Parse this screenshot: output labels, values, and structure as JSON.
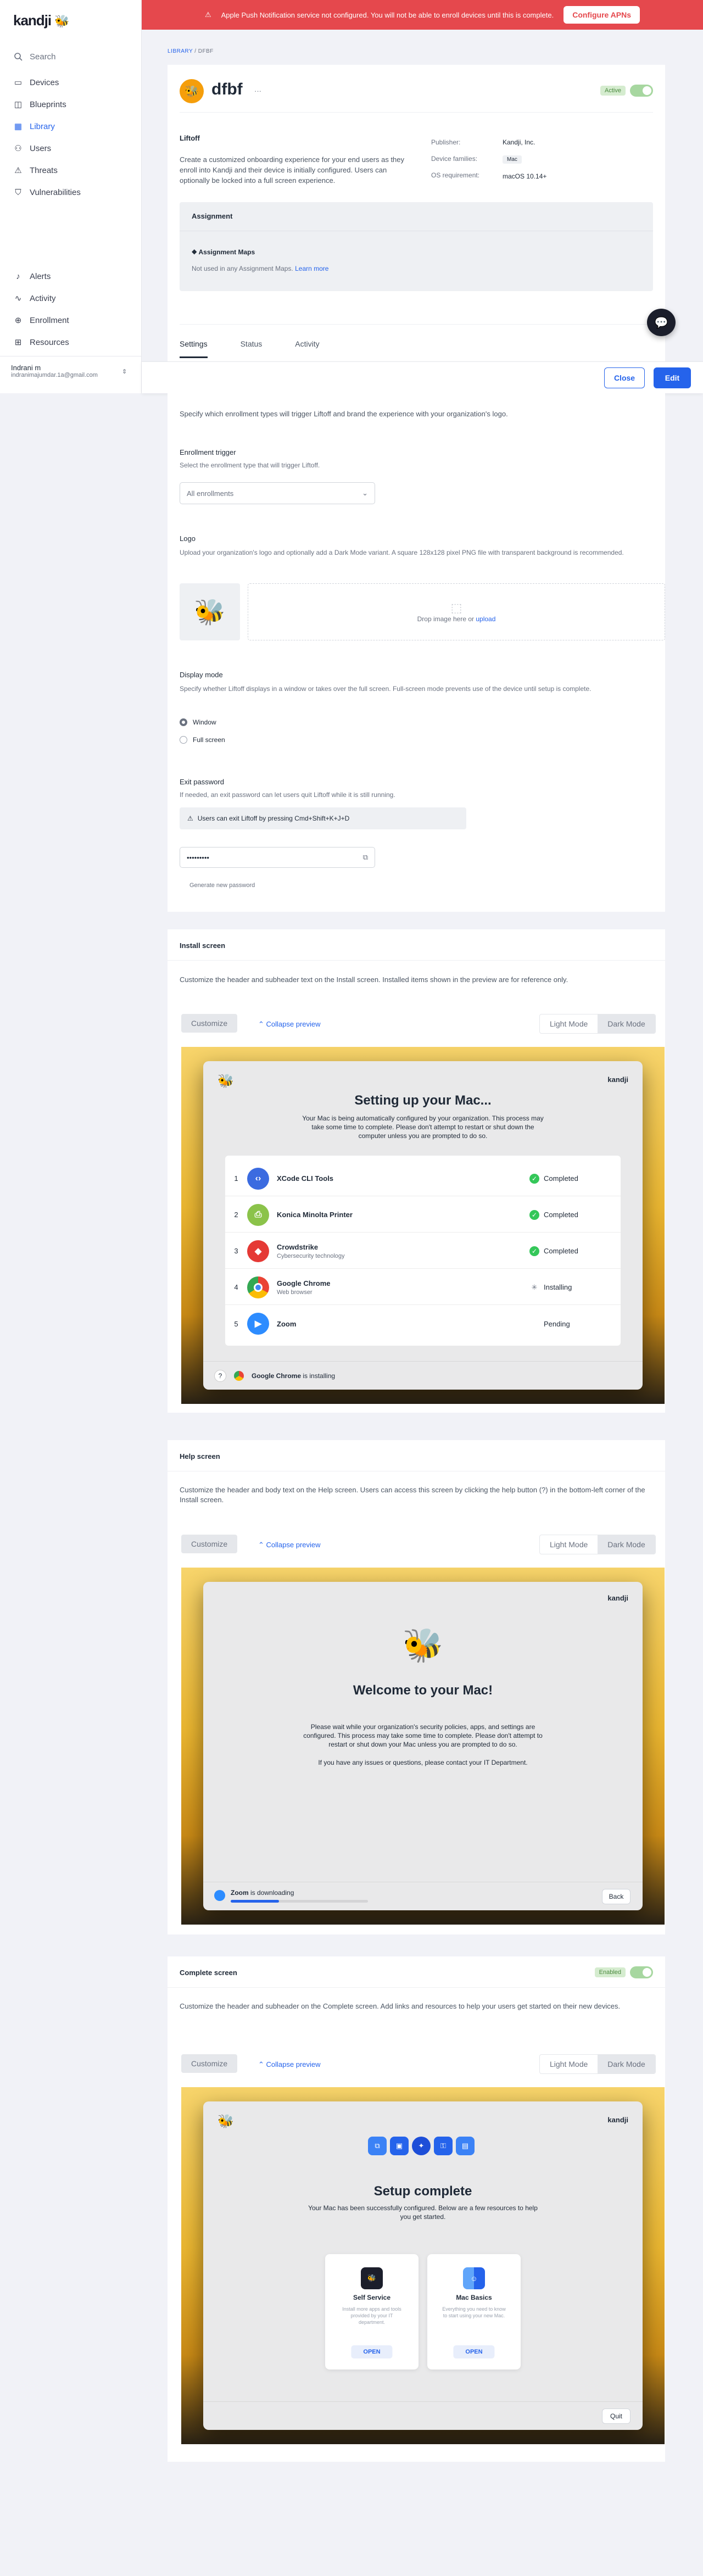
{
  "brand": {
    "logo": "kandji"
  },
  "sidebar": {
    "search": "Search",
    "items": [
      {
        "label": "Devices",
        "icon": "laptop-icon"
      },
      {
        "label": "Blueprints",
        "icon": "blueprint-icon"
      },
      {
        "label": "Library",
        "icon": "library-icon"
      },
      {
        "label": "Users",
        "icon": "users-icon"
      },
      {
        "label": "Threats",
        "icon": "threat-icon"
      },
      {
        "label": "Vulnerabilities",
        "icon": "shield-icon"
      }
    ],
    "bottom": [
      {
        "label": "Alerts",
        "icon": "bell-icon"
      },
      {
        "label": "Activity",
        "icon": "activity-icon"
      },
      {
        "label": "Enrollment",
        "icon": "enroll-icon"
      },
      {
        "label": "Resources",
        "icon": "resources-icon"
      }
    ],
    "user": {
      "name": "Indrani m",
      "email": "indranimajumdar.1a@gmail.com"
    }
  },
  "banner": {
    "text": "Apple Push Notification service not configured. You will not be able to enroll devices until this is complete.",
    "button": "Configure APNs"
  },
  "breadcrumb": {
    "root": "LIBRARY",
    "sep": "/",
    "current": "DFBF"
  },
  "item": {
    "title": "dfbf",
    "menu": "···",
    "active_label": "Active",
    "name": "Liftoff",
    "description": "Create a customized onboarding experience for your end users as they enroll into Kandji and their device is initially configured. Users can optionally be locked into a full screen experience.",
    "publisher_label": "Publisher:",
    "publisher": "Kandji, Inc.",
    "families_label": "Device families:",
    "family": "Mac",
    "os_label": "OS requirement:",
    "os": "macOS 10.14+",
    "assignment_title": "Assignment",
    "assignment_maps": "Assignment Maps",
    "assignment_note": "Not used in any Assignment Maps.",
    "learn_more": "Learn more"
  },
  "tabs": [
    "Settings",
    "Status",
    "Activity"
  ],
  "actions": {
    "close": "Close",
    "edit": "Edit"
  },
  "general": {
    "intro": "Specify which enrollment types will trigger Liftoff and brand the experience with your organization's logo.",
    "trigger_title": "Enrollment trigger",
    "trigger_help": "Select the enrollment type that will trigger Liftoff.",
    "trigger_value": "All enrollments",
    "logo_title": "Logo",
    "logo_help": "Upload your organization's logo and optionally add a Dark Mode variant. A square 128x128 pixel PNG file with transparent background is recommended.",
    "drop_text": "Drop image here or",
    "upload": "upload",
    "display_title": "Display mode",
    "display_help": "Specify whether Liftoff displays in a window or takes over the full screen. Full-screen mode prevents use of the device until setup is complete.",
    "mode_window": "Window",
    "mode_full": "Full screen",
    "exit_title": "Exit password",
    "exit_help": "If needed, an exit password can let users quit Liftoff while it is still running.",
    "exit_warning": "Users can exit Liftoff by pressing Cmd+Shift+K+J+D",
    "password": "•••••••••",
    "generate": "Generate new password"
  },
  "install": {
    "title": "Install screen",
    "help": "Customize the header and subheader text on the Install screen. Installed items shown in the preview are for reference only.",
    "customize": "Customize",
    "collapse": "Collapse preview",
    "light": "Light Mode",
    "dark": "Dark Mode",
    "heading": "Setting up your Mac...",
    "subheading": "Your Mac is being automatically configured by your organization. This process may take some time to complete. Please don't attempt to restart or shut down the computer unless you are prompted to do so.",
    "items": [
      {
        "n": "1",
        "name": "XCode CLI Tools",
        "sub": "",
        "status": "Completed",
        "color": "#3b6be0",
        "icon": "code-icon"
      },
      {
        "n": "2",
        "name": "Konica Minolta Printer",
        "sub": "",
        "status": "Completed",
        "color": "#8bc34a",
        "icon": "printer-icon"
      },
      {
        "n": "3",
        "name": "Crowdstrike",
        "sub": "Cybersecurity technology",
        "status": "Completed",
        "color": "#e53935",
        "icon": "falcon-icon"
      },
      {
        "n": "4",
        "name": "Google Chrome",
        "sub": "Web browser",
        "status": "Installing",
        "color": "#fbbc05",
        "icon": "chrome-icon"
      },
      {
        "n": "5",
        "name": "Zoom",
        "sub": "",
        "status": "Pending",
        "color": "#2d8cff",
        "icon": "zoom-icon"
      }
    ],
    "footer_app": "Google Chrome",
    "footer_text": "is installing",
    "help_q": "?"
  },
  "help_screen": {
    "title": "Help screen",
    "help": "Customize the header and body text on the Help screen. Users can access this screen by clicking the help button (?) in the bottom-left corner of the Install screen.",
    "customize": "Customize",
    "collapse": "Collapse preview",
    "light": "Light Mode",
    "dark": "Dark Mode",
    "heading": "Welcome to your Mac!",
    "body": "Please wait while your organization's security policies, apps, and settings are configured. This process may take some time to complete. Please don't attempt to restart or shut down your Mac unless you are prompted to do so.",
    "body2": "If you have any issues or questions, please contact your IT Department.",
    "footer_app": "Zoom",
    "footer_text": "is downloading",
    "back": "Back",
    "progress": 0.35
  },
  "complete": {
    "title": "Complete screen",
    "enabled": "Enabled",
    "help": "Customize the header and subheader on the Complete screen. Add links and resources to help your users get started on their new devices.",
    "customize": "Customize",
    "collapse": "Collapse preview",
    "light": "Light Mode",
    "dark": "Dark Mode",
    "heading": "Setup complete",
    "subheading": "Your Mac has been successfully configured. Below are a few resources to help you get started.",
    "resources": [
      {
        "title": "Self Service",
        "desc": "Install more apps and tools provided by your IT department.",
        "open": "OPEN"
      },
      {
        "title": "Mac Basics",
        "desc": "Everything you need to know to start using your new Mac.",
        "open": "OPEN"
      }
    ],
    "quit": "Quit"
  },
  "kandji_brand": "kandji",
  "colors": {
    "accent": "#2563eb",
    "danger": "#e5484d",
    "success": "#34c759"
  }
}
